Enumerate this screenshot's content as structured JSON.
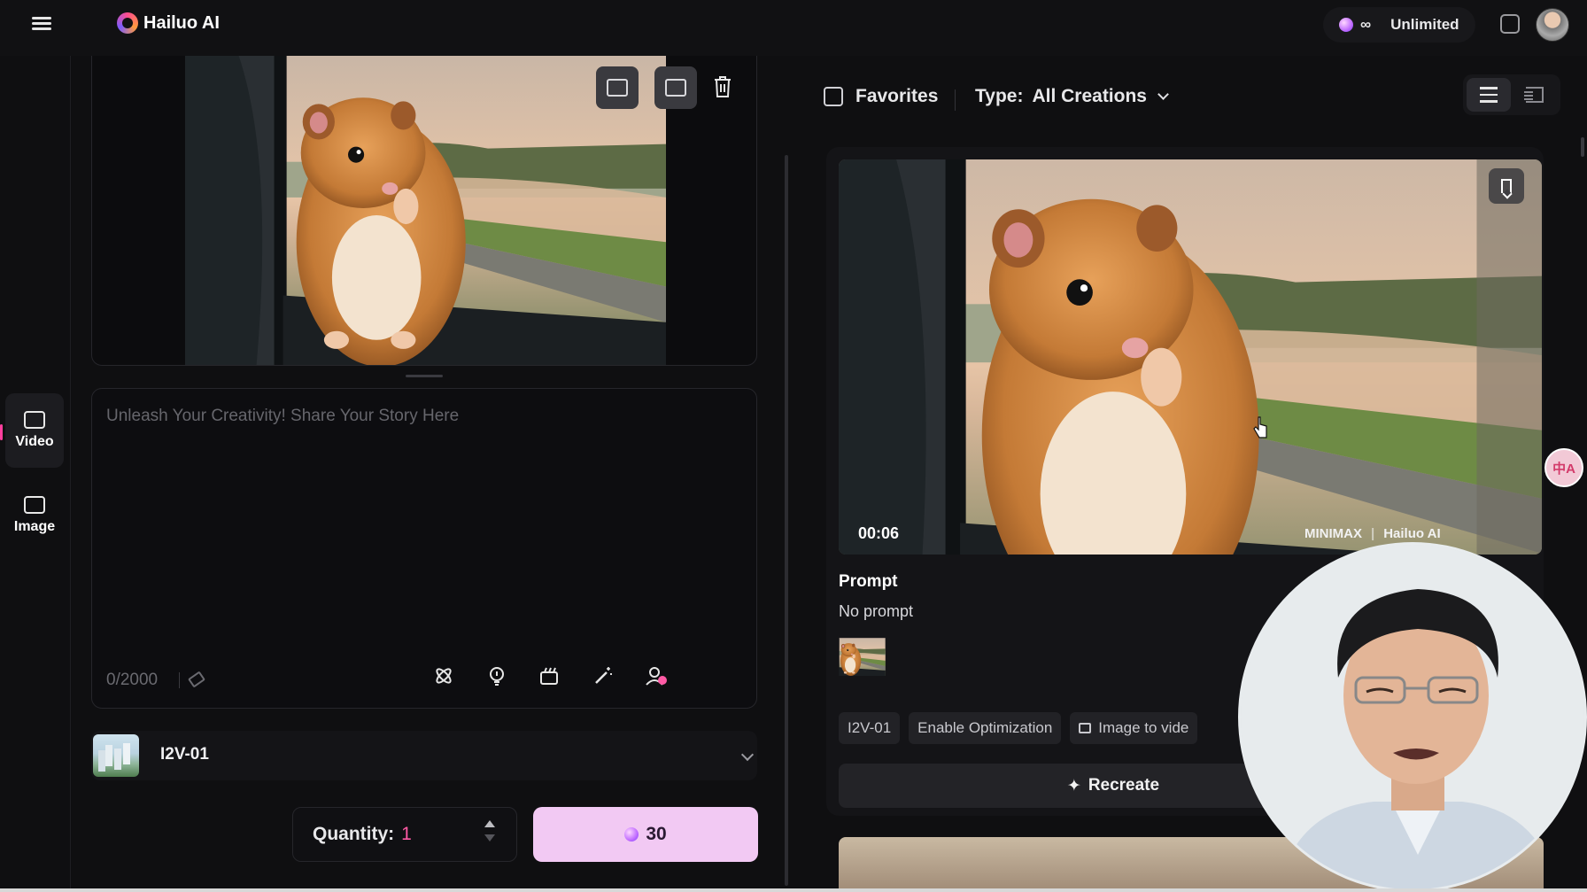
{
  "topbar": {
    "brand": "Hailuo AI",
    "plan_infinity": "∞",
    "plan_label": "Unlimited"
  },
  "rail": {
    "items": [
      {
        "label": "Video",
        "active": true
      },
      {
        "label": "Image",
        "active": false
      }
    ]
  },
  "composer": {
    "prompt_placeholder": "Unleash Your Creativity! Share Your Story Here",
    "counter": "0/2000",
    "model": "I2V-01",
    "quantity_label": "Quantity:",
    "quantity_value": "1",
    "generate_cost": "30"
  },
  "results": {
    "favorites_label": "Favorites",
    "type_label": "Type:",
    "type_value": "All Creations",
    "card": {
      "duration": "00:06",
      "watermark_left": "MINIMAX",
      "watermark_right": "Hailuo AI",
      "prompt_title": "Prompt",
      "prompt_text": "No prompt",
      "chips": [
        "I2V-01",
        "Enable Optimization",
        "Image to vide"
      ],
      "recreate_label": "Recreate"
    }
  },
  "translate_fab_label": "中A",
  "colors": {
    "accent_pink": "#ff5aa5",
    "generate_bg": "#f2c9f3",
    "background": "#0f0f11"
  }
}
